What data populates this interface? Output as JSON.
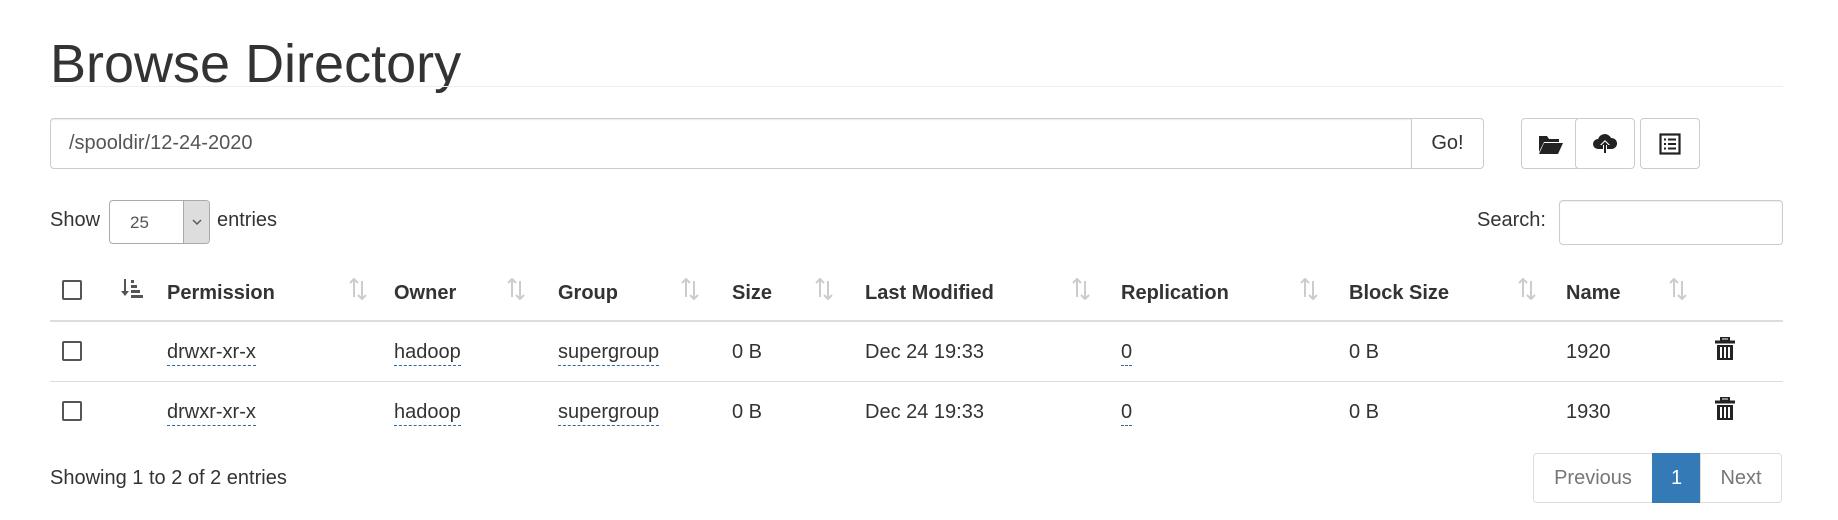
{
  "header": {
    "title": "Browse Directory"
  },
  "pathbar": {
    "path_value": "/spooldir/12-24-2020",
    "go_label": "Go!"
  },
  "toolbar": {
    "icons": [
      "folder-open-icon",
      "cloud-upload-icon",
      "list-alt-icon"
    ]
  },
  "length": {
    "show_label": "Show",
    "value": "25",
    "entries_label": "entries"
  },
  "search": {
    "label": "Search:",
    "value": ""
  },
  "table": {
    "columns": [
      "Permission",
      "Owner",
      "Group",
      "Size",
      "Last Modified",
      "Replication",
      "Block Size",
      "Name"
    ],
    "rows": [
      {
        "permission": "drwxr-xr-x",
        "owner": "hadoop",
        "group": "supergroup",
        "size": "0 B",
        "modified": "Dec 24 19:33",
        "replication": "0",
        "block_size": "0 B",
        "name": "1920"
      },
      {
        "permission": "drwxr-xr-x",
        "owner": "hadoop",
        "group": "supergroup",
        "size": "0 B",
        "modified": "Dec 24 19:33",
        "replication": "0",
        "block_size": "0 B",
        "name": "1930"
      }
    ]
  },
  "footer": {
    "info": "Showing 1 to 2 of 2 entries",
    "previous": "Previous",
    "current_page": "1",
    "next": "Next"
  },
  "colors": {
    "link": "#337ab7",
    "active_page": "#337ab7",
    "border": "#dddddd"
  }
}
